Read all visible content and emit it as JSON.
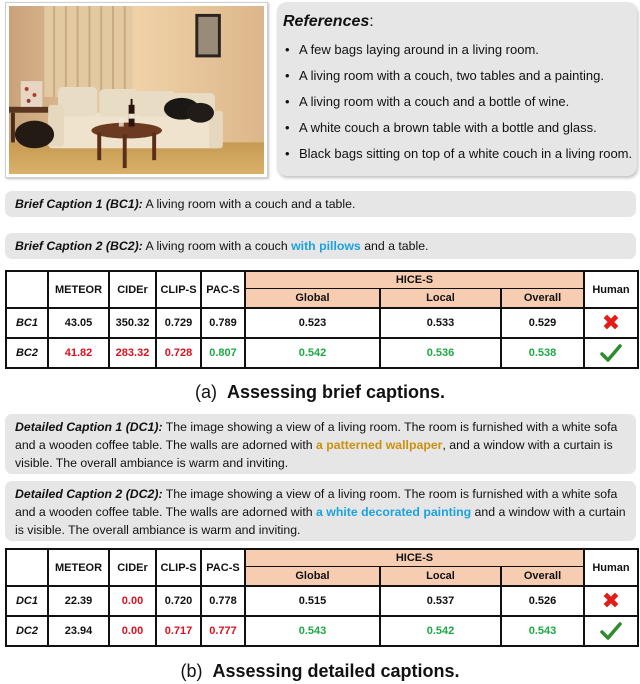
{
  "photo": {
    "alt": "living room with white couch, wooden coffee table, wine bottle, black bags, curtain and painting"
  },
  "references": {
    "title": "References",
    "colon": ":",
    "bullet": "•",
    "items": [
      "A few bags laying around in a living room.",
      "A living room with a couch, two tables and a painting.",
      "A living room with a couch and a bottle of wine.",
      "A white couch a brown table with a bottle and glass.",
      "Black bags sitting on top of a white couch in a living room."
    ]
  },
  "brief_captions": [
    {
      "label": "Brief Caption 1 (BC1):",
      "pre": " A living room with a couch and a table.",
      "highlight": "",
      "post": ""
    },
    {
      "label": "Brief Caption 2 (BC2):",
      "pre": " A living room with a couch ",
      "highlight": "with pillows",
      "post": " and a table."
    }
  ],
  "detailed_captions": [
    {
      "label": "Detailed Caption 1 (DC1):",
      "pre": " The image showing a view of a living room. The room is furnished with a white sofa and a wooden coffee table. The walls are adorned with ",
      "highlight": "a patterned wallpaper",
      "post": ", and a window with a curtain is visible. The overall ambiance is warm and inviting."
    },
    {
      "label": "Detailed Caption 2 (DC2):",
      "pre": " The image showing a view of a living room. The room is furnished with a white sofa and a wooden coffee table. The walls are adorned with ",
      "highlight": "a white decorated painting",
      "post": " and a window with a curtain is visible. The overall ambiance is warm and inviting."
    }
  ],
  "colors": {
    "highlight_blue": "#1aa3e0",
    "highlight_gold": "#c9920e",
    "worse_red": "#d8121f",
    "better_green": "#1ea845",
    "hice_header_bg": "#f7cdb2",
    "caption_box_bg": "#e6e6e6"
  },
  "table_headers": {
    "meteor": "METEOR",
    "cider": "CIDEr",
    "clips": "CLIP-S",
    "pacs": "PAC-S",
    "hice": "HICE-S",
    "global": "Global",
    "local": "Local",
    "overall": "Overall",
    "human": "Human"
  },
  "table_brief": {
    "rows": [
      {
        "label": "BC1",
        "meteor": "43.05",
        "cider": "350.32",
        "clips": "0.729",
        "pacs": "0.789",
        "global": "0.523",
        "local": "0.533",
        "overall": "0.529",
        "human": "✗",
        "human_judgment": "incorrect"
      },
      {
        "label": "BC2",
        "meteor": "41.82",
        "cider": "283.32",
        "clips": "0.728",
        "pacs": "0.807",
        "global": "0.542",
        "local": "0.536",
        "overall": "0.538",
        "human": "✓",
        "human_judgment": "correct"
      }
    ]
  },
  "table_detailed": {
    "rows": [
      {
        "label": "DC1",
        "meteor": "22.39",
        "cider": "0.00",
        "clips": "0.720",
        "pacs": "0.778",
        "global": "0.515",
        "local": "0.537",
        "overall": "0.526",
        "human": "✗",
        "human_judgment": "incorrect"
      },
      {
        "label": "DC2",
        "meteor": "23.94",
        "cider": "0.00",
        "clips": "0.717",
        "pacs": "0.777",
        "global": "0.543",
        "local": "0.542",
        "overall": "0.543",
        "human": "✓",
        "human_judgment": "correct"
      }
    ]
  },
  "subcaptions": {
    "a_tag": "(a)",
    "a_text": "Assessing brief captions.",
    "b_tag": "(b)",
    "b_text": "Assessing detailed captions."
  }
}
